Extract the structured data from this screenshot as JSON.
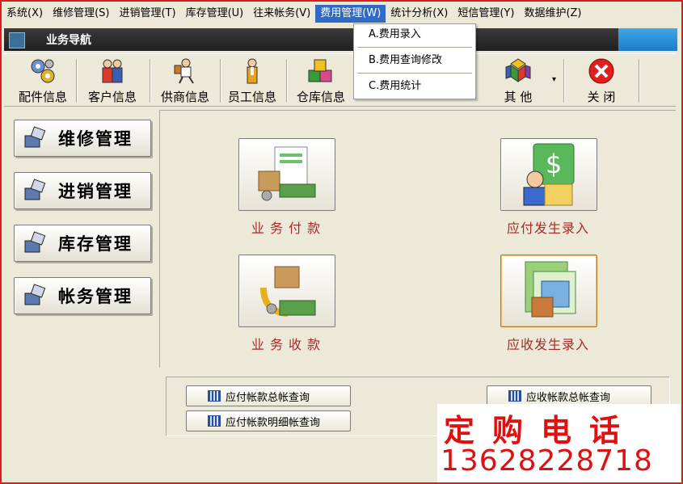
{
  "menubar": {
    "items": [
      {
        "label": "系统(X)"
      },
      {
        "label": "维修管理(S)"
      },
      {
        "label": "进销管理(T)"
      },
      {
        "label": "库存管理(U)"
      },
      {
        "label": "往来帐务(V)"
      },
      {
        "label": "费用管理(W)"
      },
      {
        "label": "统计分析(X)"
      },
      {
        "label": "短信管理(Y)"
      },
      {
        "label": "数据维护(Z)"
      }
    ]
  },
  "dropdown": {
    "items": [
      {
        "label": "A.费用录入"
      },
      {
        "label": "B.费用查询修改"
      },
      {
        "label": "C.费用统计"
      }
    ]
  },
  "titlebar": {
    "title": "业务导航"
  },
  "toolbar": {
    "items": [
      {
        "label": "配件信息",
        "icon": "gears-icon"
      },
      {
        "label": "客户信息",
        "icon": "people-icon"
      },
      {
        "label": "供商信息",
        "icon": "supplier-icon"
      },
      {
        "label": "员工信息",
        "icon": "employee-icon"
      },
      {
        "label": "仓库信息",
        "icon": "warehouse-icon"
      },
      {
        "label": "其 他",
        "icon": "other-icon"
      },
      {
        "label": "关 闭",
        "icon": "close-icon"
      }
    ]
  },
  "leftnav": {
    "items": [
      {
        "label": "维修管理"
      },
      {
        "label": "进销管理"
      },
      {
        "label": "库存管理"
      },
      {
        "label": "帐务管理"
      }
    ]
  },
  "main": {
    "buttons": [
      {
        "label": "业 务 付 款"
      },
      {
        "label": "应付发生录入"
      },
      {
        "label": "业 务 收 款"
      },
      {
        "label": "应收发生录入"
      }
    ]
  },
  "query": {
    "buttons": [
      {
        "label": "应付帐款总帐查询"
      },
      {
        "label": "应付帐款明细帐查询"
      },
      {
        "label": "应收帐款总帐查询"
      }
    ]
  },
  "promo": {
    "line1": "定购电话",
    "line2": "13628228718"
  },
  "colors": {
    "accent": "#316ac5",
    "promo": "#e01010",
    "label": "#a52a2a"
  }
}
